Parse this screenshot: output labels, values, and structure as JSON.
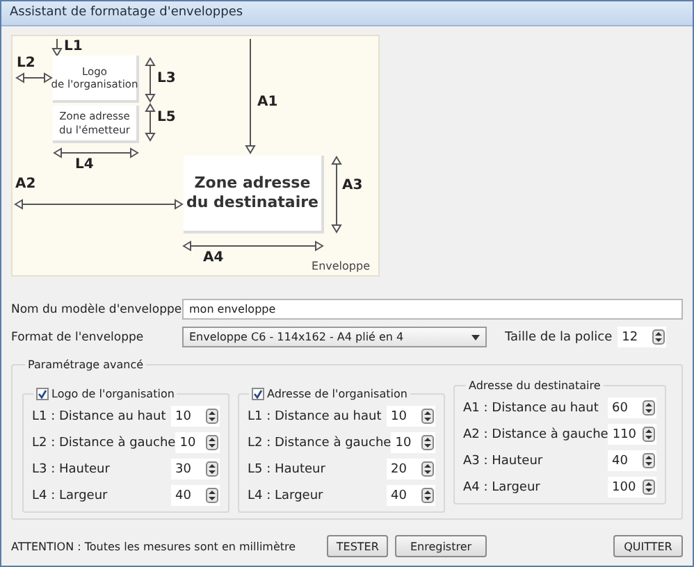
{
  "window": {
    "title": "Assistant de formatage d'enveloppes"
  },
  "diagram": {
    "boxes": [
      {
        "kind": "logo",
        "lines": [
          "Logo",
          "de l'organisation"
        ]
      },
      {
        "kind": "sender",
        "lines": [
          "Zone adresse",
          "du l'émetteur"
        ]
      },
      {
        "kind": "recipient",
        "lines": [
          "Zone adresse",
          "du destinataire"
        ]
      }
    ],
    "arrows": [
      {
        "label": "L1"
      },
      {
        "label": "L2"
      },
      {
        "label": "L3"
      },
      {
        "label": "L5"
      },
      {
        "label": "L4"
      },
      {
        "label": "A1"
      },
      {
        "label": "A2"
      },
      {
        "label": "A3"
      },
      {
        "label": "A4"
      }
    ],
    "caption": "Enveloppe"
  },
  "model_name": {
    "label": "Nom du modèle d'enveloppe",
    "value": "mon enveloppe"
  },
  "format": {
    "label": "Format de l'enveloppe",
    "value": "Enveloppe C6 - 114x162 - A4 plié en 4"
  },
  "font_size": {
    "label": "Taille de la police",
    "value": "12"
  },
  "advanced": {
    "title": "Paramétrage avancé",
    "groups": [
      {
        "kind": "checkbox",
        "title": "Logo de l'organisation",
        "checked": true,
        "rows": [
          {
            "label": "L1 : Distance au haut",
            "value": "10"
          },
          {
            "label": "L2 : Distance à gauche",
            "value": "10"
          },
          {
            "label": "L3 : Hauteur",
            "value": "30"
          },
          {
            "label": "L4 : Largeur",
            "value": "40"
          }
        ]
      },
      {
        "kind": "checkbox",
        "title": "Adresse de l'organisation",
        "checked": true,
        "rows": [
          {
            "label": "L1 : Distance au haut",
            "value": "10"
          },
          {
            "label": "L2 : Distance à gauche",
            "value": "10"
          },
          {
            "label": "L5 : Hauteur",
            "value": "20"
          },
          {
            "label": "L4 : Largeur",
            "value": "40"
          }
        ]
      },
      {
        "kind": "titled",
        "title": "Adresse du destinataire",
        "rows": [
          {
            "label": "A1 : Distance au haut",
            "value": "60"
          },
          {
            "label": "A2 : Distance à gauche",
            "value": "110"
          },
          {
            "label": "A3 : Hauteur",
            "value": "40"
          },
          {
            "label": "A4 : Largeur",
            "value": "100"
          }
        ]
      }
    ]
  },
  "footer": {
    "note": "ATTENTION : Toutes les mesures sont en millimètre",
    "buttons": [
      {
        "label": "TESTER"
      },
      {
        "label": "Enregistrer"
      },
      {
        "label": "QUITTER"
      }
    ]
  }
}
